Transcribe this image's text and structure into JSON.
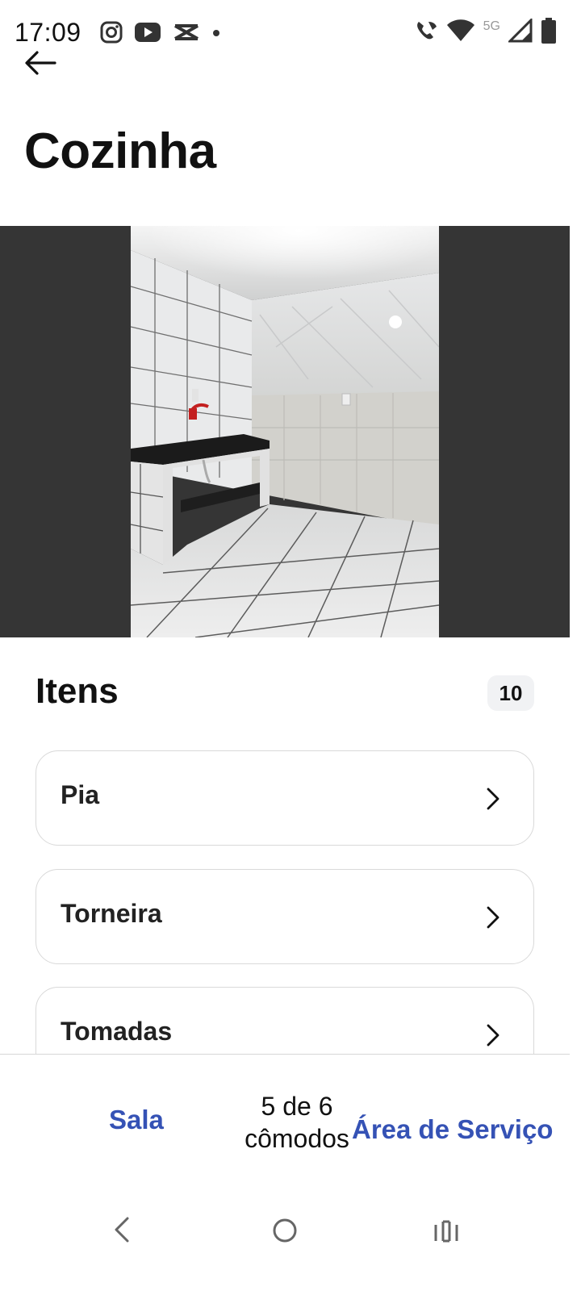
{
  "status_bar": {
    "time": "17:09",
    "network": "5G",
    "left_icons": [
      "instagram-icon",
      "youtube-icon",
      "capcut-icon",
      "dot-icon"
    ],
    "right_icons": [
      "wifi-call-icon",
      "wifi-icon",
      "signal-icon",
      "battery-icon"
    ]
  },
  "header": {
    "title": "Cozinha"
  },
  "photo": {
    "description_icon": "kitchen-photo"
  },
  "items_section": {
    "title": "Itens",
    "count": "10",
    "items": [
      {
        "label": "Pia"
      },
      {
        "label": "Torneira"
      },
      {
        "label": "Tomadas"
      }
    ]
  },
  "bottom_nav": {
    "prev_label": "Sala",
    "progress_line1": "5 de 6",
    "progress_line2": "cômodos",
    "next_label": "Área de Serviço"
  },
  "colors": {
    "accent": "#3552b5",
    "photo_background": "#353535",
    "badge_background": "#f1f2f4"
  }
}
